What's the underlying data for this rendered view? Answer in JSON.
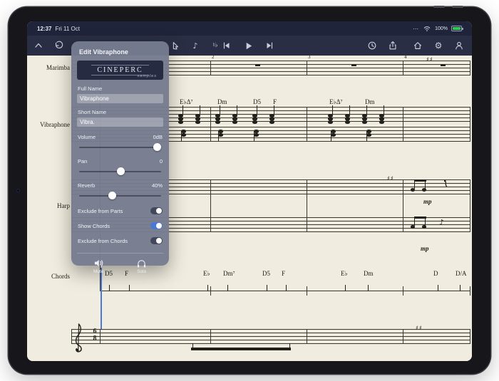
{
  "colors": {
    "navy": "#2a2e44",
    "status_navy": "#20243a",
    "score_bg": "#f0ecdf",
    "accent_blue": "#4a79d4",
    "toggle_off": "#42475c",
    "battery_green": "#34c759",
    "playhead": "#4b79d8"
  },
  "status_bar": {
    "time": "12:37",
    "date": "Fri 11 Oct",
    "battery_percent": "100%"
  },
  "toolbar": {
    "icons": [
      "collapse-chevron",
      "undo",
      "pointer-tool",
      "note-tool",
      "accidental-tool",
      "skip-to-start",
      "play",
      "skip-to-end",
      "playback-clock",
      "share",
      "home",
      "settings-gear",
      "account"
    ]
  },
  "panel": {
    "title": "Edit Vibraphone",
    "logo": {
      "name": "CinePerc",
      "sub": "samples"
    },
    "fields": [
      {
        "label": "Full Name",
        "value": "Vibraphone"
      },
      {
        "label": "Short Name",
        "value": "Vibra."
      }
    ],
    "sliders": [
      {
        "label": "Volume",
        "value": "0dB",
        "percent": 95
      },
      {
        "label": "Pan",
        "value": "0",
        "percent": 50
      },
      {
        "label": "Reverb",
        "value": "40%",
        "percent": 40
      }
    ],
    "toggles": [
      {
        "label": "Exclude from Parts",
        "on": true,
        "track": "#42475c"
      },
      {
        "label": "Show Chords",
        "on": true,
        "track": "#4a79d4"
      },
      {
        "label": "Exclude from Chords",
        "on": true,
        "track": "#42475c"
      }
    ],
    "buttons": [
      {
        "label": "Mute"
      },
      {
        "label": "Solo"
      }
    ]
  },
  "score": {
    "instruments": [
      "Marimba",
      "Vibraphone",
      "Harp",
      "Chords"
    ],
    "measure_numbers": [
      "2",
      "3",
      "4"
    ],
    "vibraphone_chords": [
      "E♭Δ⁷",
      "Dm",
      "D5",
      "F",
      "E♭Δ⁷",
      "Dm"
    ],
    "chord_track": [
      "D5",
      "F",
      "E♭",
      "Dm⁷",
      "D5",
      "F",
      "E♭",
      "Dm",
      "D",
      "D/A"
    ],
    "dynamics": [
      "mp",
      "mp"
    ],
    "time_signature": {
      "upper": "6",
      "lower": "8"
    },
    "key_signature": "♯♯"
  }
}
